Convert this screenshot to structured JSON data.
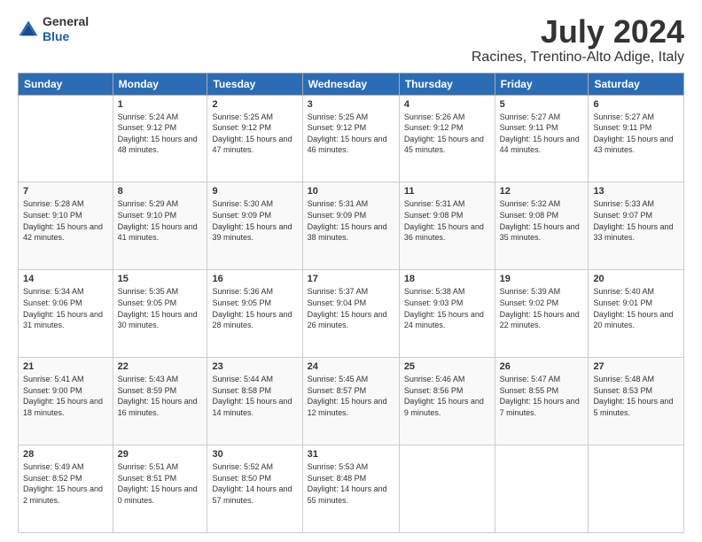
{
  "header": {
    "logo_line1": "General",
    "logo_line2": "Blue",
    "month_year": "July 2024",
    "location": "Racines, Trentino-Alto Adige, Italy"
  },
  "weekdays": [
    "Sunday",
    "Monday",
    "Tuesday",
    "Wednesday",
    "Thursday",
    "Friday",
    "Saturday"
  ],
  "weeks": [
    [
      {
        "day": null,
        "info": null
      },
      {
        "day": "1",
        "sunrise": "5:24 AM",
        "sunset": "9:12 PM",
        "daylight": "15 hours and 48 minutes."
      },
      {
        "day": "2",
        "sunrise": "5:25 AM",
        "sunset": "9:12 PM",
        "daylight": "15 hours and 47 minutes."
      },
      {
        "day": "3",
        "sunrise": "5:25 AM",
        "sunset": "9:12 PM",
        "daylight": "15 hours and 46 minutes."
      },
      {
        "day": "4",
        "sunrise": "5:26 AM",
        "sunset": "9:12 PM",
        "daylight": "15 hours and 45 minutes."
      },
      {
        "day": "5",
        "sunrise": "5:27 AM",
        "sunset": "9:11 PM",
        "daylight": "15 hours and 44 minutes."
      },
      {
        "day": "6",
        "sunrise": "5:27 AM",
        "sunset": "9:11 PM",
        "daylight": "15 hours and 43 minutes."
      }
    ],
    [
      {
        "day": "7",
        "sunrise": "5:28 AM",
        "sunset": "9:10 PM",
        "daylight": "15 hours and 42 minutes."
      },
      {
        "day": "8",
        "sunrise": "5:29 AM",
        "sunset": "9:10 PM",
        "daylight": "15 hours and 41 minutes."
      },
      {
        "day": "9",
        "sunrise": "5:30 AM",
        "sunset": "9:09 PM",
        "daylight": "15 hours and 39 minutes."
      },
      {
        "day": "10",
        "sunrise": "5:31 AM",
        "sunset": "9:09 PM",
        "daylight": "15 hours and 38 minutes."
      },
      {
        "day": "11",
        "sunrise": "5:31 AM",
        "sunset": "9:08 PM",
        "daylight": "15 hours and 36 minutes."
      },
      {
        "day": "12",
        "sunrise": "5:32 AM",
        "sunset": "9:08 PM",
        "daylight": "15 hours and 35 minutes."
      },
      {
        "day": "13",
        "sunrise": "5:33 AM",
        "sunset": "9:07 PM",
        "daylight": "15 hours and 33 minutes."
      }
    ],
    [
      {
        "day": "14",
        "sunrise": "5:34 AM",
        "sunset": "9:06 PM",
        "daylight": "15 hours and 31 minutes."
      },
      {
        "day": "15",
        "sunrise": "5:35 AM",
        "sunset": "9:05 PM",
        "daylight": "15 hours and 30 minutes."
      },
      {
        "day": "16",
        "sunrise": "5:36 AM",
        "sunset": "9:05 PM",
        "daylight": "15 hours and 28 minutes."
      },
      {
        "day": "17",
        "sunrise": "5:37 AM",
        "sunset": "9:04 PM",
        "daylight": "15 hours and 26 minutes."
      },
      {
        "day": "18",
        "sunrise": "5:38 AM",
        "sunset": "9:03 PM",
        "daylight": "15 hours and 24 minutes."
      },
      {
        "day": "19",
        "sunrise": "5:39 AM",
        "sunset": "9:02 PM",
        "daylight": "15 hours and 22 minutes."
      },
      {
        "day": "20",
        "sunrise": "5:40 AM",
        "sunset": "9:01 PM",
        "daylight": "15 hours and 20 minutes."
      }
    ],
    [
      {
        "day": "21",
        "sunrise": "5:41 AM",
        "sunset": "9:00 PM",
        "daylight": "15 hours and 18 minutes."
      },
      {
        "day": "22",
        "sunrise": "5:43 AM",
        "sunset": "8:59 PM",
        "daylight": "15 hours and 16 minutes."
      },
      {
        "day": "23",
        "sunrise": "5:44 AM",
        "sunset": "8:58 PM",
        "daylight": "15 hours and 14 minutes."
      },
      {
        "day": "24",
        "sunrise": "5:45 AM",
        "sunset": "8:57 PM",
        "daylight": "15 hours and 12 minutes."
      },
      {
        "day": "25",
        "sunrise": "5:46 AM",
        "sunset": "8:56 PM",
        "daylight": "15 hours and 9 minutes."
      },
      {
        "day": "26",
        "sunrise": "5:47 AM",
        "sunset": "8:55 PM",
        "daylight": "15 hours and 7 minutes."
      },
      {
        "day": "27",
        "sunrise": "5:48 AM",
        "sunset": "8:53 PM",
        "daylight": "15 hours and 5 minutes."
      }
    ],
    [
      {
        "day": "28",
        "sunrise": "5:49 AM",
        "sunset": "8:52 PM",
        "daylight": "15 hours and 2 minutes."
      },
      {
        "day": "29",
        "sunrise": "5:51 AM",
        "sunset": "8:51 PM",
        "daylight": "15 hours and 0 minutes."
      },
      {
        "day": "30",
        "sunrise": "5:52 AM",
        "sunset": "8:50 PM",
        "daylight": "14 hours and 57 minutes."
      },
      {
        "day": "31",
        "sunrise": "5:53 AM",
        "sunset": "8:48 PM",
        "daylight": "14 hours and 55 minutes."
      },
      {
        "day": null,
        "info": null
      },
      {
        "day": null,
        "info": null
      },
      {
        "day": null,
        "info": null
      }
    ]
  ]
}
